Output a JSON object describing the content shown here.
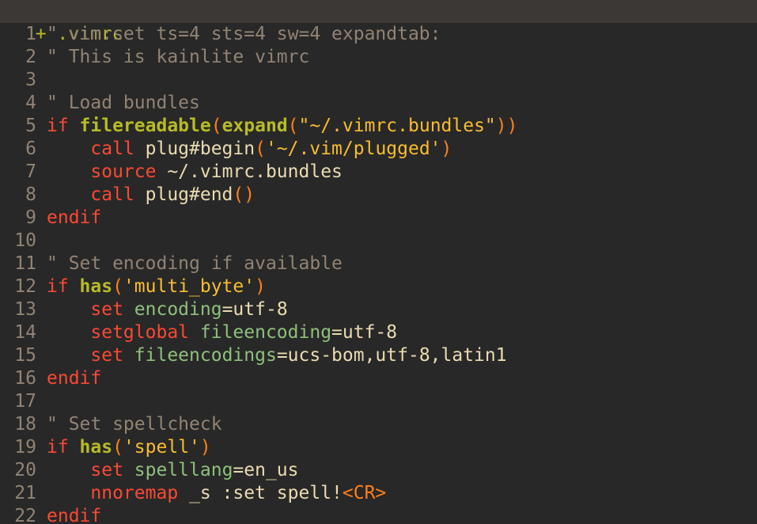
{
  "tabline": {
    "label": "+ .vimrc"
  },
  "lines": [
    {
      "n": "1",
      "segs": [
        [
          "cmt",
          "\" vim:set ts=4 sts=4 sw=4 expandtab:"
        ]
      ]
    },
    {
      "n": "2",
      "segs": [
        [
          "cmt",
          "\" This is kainlite vimrc"
        ]
      ]
    },
    {
      "n": "3",
      "segs": []
    },
    {
      "n": "4",
      "segs": [
        [
          "cmt",
          "\" Load bundles"
        ]
      ]
    },
    {
      "n": "5",
      "segs": [
        [
          "kw",
          "if "
        ],
        [
          "fn",
          "filereadable"
        ],
        [
          "paren",
          "("
        ],
        [
          "fn",
          "expand"
        ],
        [
          "paren",
          "("
        ],
        [
          "str2",
          "\"~/.vimrc.bundles\""
        ],
        [
          "paren",
          "))"
        ]
      ]
    },
    {
      "n": "6",
      "segs": [
        [
          "plain",
          "    "
        ],
        [
          "kw",
          "call"
        ],
        [
          "plain",
          " plug#begin"
        ],
        [
          "paren",
          "("
        ],
        [
          "str2",
          "'~/.vim/plugged'"
        ],
        [
          "paren",
          ")"
        ]
      ]
    },
    {
      "n": "7",
      "segs": [
        [
          "plain",
          "    "
        ],
        [
          "kw",
          "source"
        ],
        [
          "plain",
          " ~/.vimrc.bundles"
        ]
      ]
    },
    {
      "n": "8",
      "segs": [
        [
          "plain",
          "    "
        ],
        [
          "kw",
          "call"
        ],
        [
          "plain",
          " plug#end"
        ],
        [
          "paren",
          "()"
        ]
      ]
    },
    {
      "n": "9",
      "segs": [
        [
          "kw",
          "endif"
        ]
      ]
    },
    {
      "n": "10",
      "segs": []
    },
    {
      "n": "11",
      "segs": [
        [
          "cmt",
          "\" Set encoding if available"
        ]
      ]
    },
    {
      "n": "12",
      "segs": [
        [
          "kw",
          "if "
        ],
        [
          "fn",
          "has"
        ],
        [
          "paren",
          "("
        ],
        [
          "str2",
          "'multi_byte'"
        ],
        [
          "paren",
          ")"
        ]
      ]
    },
    {
      "n": "13",
      "segs": [
        [
          "plain",
          "    "
        ],
        [
          "kw",
          "set"
        ],
        [
          "plain",
          " "
        ],
        [
          "opt",
          "encoding"
        ],
        [
          "plain",
          "=utf-8"
        ]
      ]
    },
    {
      "n": "14",
      "segs": [
        [
          "plain",
          "    "
        ],
        [
          "kw",
          "setglobal"
        ],
        [
          "plain",
          " "
        ],
        [
          "opt",
          "fileencoding"
        ],
        [
          "plain",
          "=utf-8"
        ]
      ]
    },
    {
      "n": "15",
      "segs": [
        [
          "plain",
          "    "
        ],
        [
          "kw",
          "set"
        ],
        [
          "plain",
          " "
        ],
        [
          "opt",
          "fileencodings"
        ],
        [
          "plain",
          "=ucs-bom,utf-8,latin1"
        ]
      ]
    },
    {
      "n": "16",
      "segs": [
        [
          "kw",
          "endif"
        ]
      ]
    },
    {
      "n": "17",
      "segs": []
    },
    {
      "n": "18",
      "segs": [
        [
          "cmt",
          "\" Set spellcheck"
        ]
      ]
    },
    {
      "n": "19",
      "segs": [
        [
          "kw",
          "if "
        ],
        [
          "fn",
          "has"
        ],
        [
          "paren",
          "("
        ],
        [
          "str2",
          "'spell'"
        ],
        [
          "paren",
          ")"
        ]
      ]
    },
    {
      "n": "20",
      "segs": [
        [
          "plain",
          "    "
        ],
        [
          "kw",
          "set"
        ],
        [
          "plain",
          " "
        ],
        [
          "opt",
          "spelllang"
        ],
        [
          "plain",
          "=en_us"
        ]
      ]
    },
    {
      "n": "21",
      "segs": [
        [
          "plain",
          "    "
        ],
        [
          "kw",
          "nnoremap"
        ],
        [
          "plain",
          " _s :set spell!"
        ],
        [
          "spec",
          "<CR>"
        ]
      ]
    },
    {
      "n": "22",
      "segs": [
        [
          "kw",
          "endif"
        ]
      ]
    }
  ],
  "colors": {
    "background": "#282828",
    "tabline_bg": "#3c3836",
    "line_number": "#928374",
    "comment": "#928374",
    "keyword": "#fb4934",
    "function": "#b8bb26",
    "paren": "#fe8019",
    "string": "#fabd2f",
    "option": "#8ec07c",
    "text": "#ebdbb2"
  }
}
